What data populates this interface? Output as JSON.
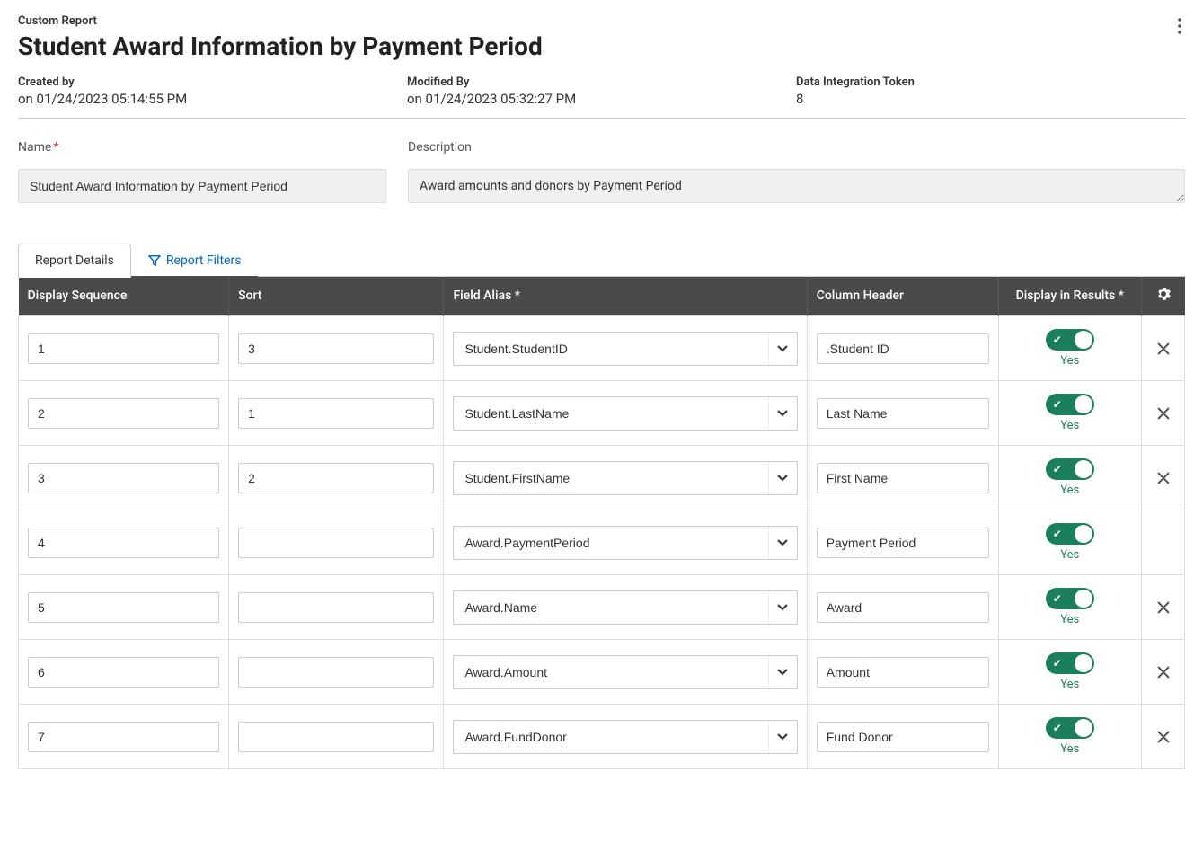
{
  "breadcrumb": "Custom Report",
  "page_title": "Student Award Information by Payment Period",
  "meta": {
    "created_label": "Created by",
    "created_value": "on 01/24/2023 05:14:55 PM",
    "modified_label": "Modified By",
    "modified_value": "on 01/24/2023 05:32:27 PM",
    "token_label": "Data Integration Token",
    "token_value": "8"
  },
  "form": {
    "name_label": "Name",
    "name_value": "Student Award Information by Payment Period",
    "desc_label": "Description",
    "desc_value": "Award amounts and donors by Payment Period"
  },
  "tabs": {
    "details": "Report Details",
    "filters": "Report Filters"
  },
  "table": {
    "headers": {
      "seq": "Display Sequence",
      "sort": "Sort",
      "alias": "Field Alias *",
      "colhead": "Column Header",
      "display": "Display in Results *"
    },
    "yes_label": "Yes",
    "rows": [
      {
        "seq": "1",
        "sort": "3",
        "alias": "Student.StudentID",
        "header": ".Student ID",
        "display": true,
        "deletable": true
      },
      {
        "seq": "2",
        "sort": "1",
        "alias": "Student.LastName",
        "header": "Last Name",
        "display": true,
        "deletable": true
      },
      {
        "seq": "3",
        "sort": "2",
        "alias": "Student.FirstName",
        "header": "First Name",
        "display": true,
        "deletable": true
      },
      {
        "seq": "4",
        "sort": "",
        "alias": "Award.PaymentPeriod",
        "header": "Payment Period",
        "display": true,
        "deletable": false
      },
      {
        "seq": "5",
        "sort": "",
        "alias": "Award.Name",
        "header": "Award",
        "display": true,
        "deletable": true
      },
      {
        "seq": "6",
        "sort": "",
        "alias": "Award.Amount",
        "header": "Amount",
        "display": true,
        "deletable": true
      },
      {
        "seq": "7",
        "sort": "",
        "alias": "Award.FundDonor",
        "header": "Fund Donor",
        "display": true,
        "deletable": true
      }
    ]
  }
}
